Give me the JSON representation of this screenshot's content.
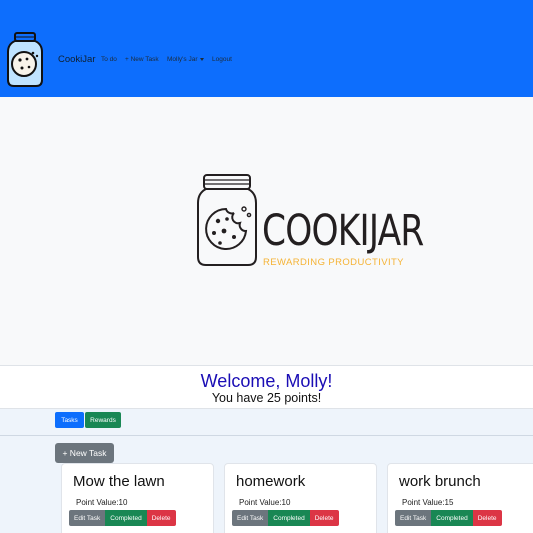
{
  "navbar": {
    "brand": "CookiJar",
    "links": {
      "todo": "To do",
      "new_task": "+ New Task",
      "jar": "Molly's Jar",
      "logout": "Logout"
    }
  },
  "hero": {
    "title": "COOKIJAR",
    "tagline": "REWARDING PRODUCTIVITY"
  },
  "welcome": {
    "greeting": "Welcome, Molly!",
    "points": "You have 25 points!"
  },
  "tabs": {
    "tasks": "Tasks",
    "rewards": "Rewards"
  },
  "new_task_button": "+ New Task",
  "tasks": [
    {
      "title": "Mow the lawn",
      "points": "Point Value:10"
    },
    {
      "title": "homework",
      "points": "Point Value:10"
    },
    {
      "title": "work brunch",
      "points": "Point Value:15"
    }
  ],
  "card_actions": {
    "edit": "Edit Task",
    "complete": "Completed",
    "delete": "Delete"
  },
  "colors": {
    "primary": "#0d6efd",
    "success": "#198754",
    "danger": "#dc3545",
    "secondary": "#6c757d",
    "tagline": "#f5b335",
    "greeting": "#1a0db5"
  },
  "icons": {
    "logo": "cookie-jar-icon"
  }
}
